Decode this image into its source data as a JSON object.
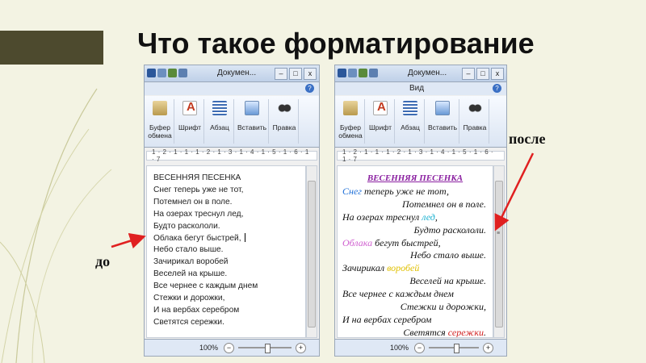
{
  "slide": {
    "title": "Что такое форматирование",
    "label_before": "до",
    "label_after": "после"
  },
  "accent_color": "#e02020",
  "window": {
    "title": "Докумен...",
    "view_tab": "Вид",
    "ribbon_groups": [
      {
        "label": "Буфер\nобмена",
        "icon": "clipboard-icon"
      },
      {
        "label": "Шрифт",
        "icon": "font-color-icon"
      },
      {
        "label": "Абзац",
        "icon": "paragraph-icon"
      },
      {
        "label": "Вставить",
        "icon": "insert-picture-icon"
      },
      {
        "label": "Правка",
        "icon": "binoculars-icon"
      }
    ],
    "ruler": "1 · 2 · 1 · 1 · 1 · 2 · 1 · 3 · 1 · 4 · 1 · 5 · 1 · 6 · 1 · 7",
    "zoom": "100%",
    "zoom_minus": "−",
    "zoom_plus": "+",
    "min_btn": "–",
    "max_btn": "□",
    "close_btn": "x"
  },
  "poem_plain": [
    "ВЕСЕННЯЯ ПЕСЕНКА",
    "Снег теперь уже не тот,",
    "Потемнел он в поле.",
    "На озерах треснул лед,",
    "Будто раскололи.",
    "Облака бегут быстрей,",
    "Небо стало выше.",
    "Зачирикал воробей",
    "Веселей на крыше.",
    "Все чернее с каждым днем",
    "Стежки и дорожки,",
    "И на вербах серебром",
    "Светятся сережки."
  ],
  "poem_formatted": {
    "title": "ВЕСЕННЯЯ ПЕСЕНКА",
    "l1_word": "Снег",
    "l1_rest": " теперь уже не тот,",
    "l2": "Потемнел он в поле.",
    "l3_start": "На озерах треснул ",
    "l3_word": "лед",
    "l3_end": ",",
    "l4": "Будто раскололи.",
    "l5_word": "Облака",
    "l5_rest": " бегут быстрей,",
    "l6": "Небо стало выше.",
    "l7_start": "Зачирикал ",
    "l7_word": "воробей",
    "l8": "Веселей на крыше.",
    "l9": "Все чернее с каждым днем",
    "l10": "Стежки и дорожки,",
    "l11": "И на вербах серебром",
    "l12_start": "Светятся ",
    "l12_word": "сережки",
    "l12_end": "."
  }
}
